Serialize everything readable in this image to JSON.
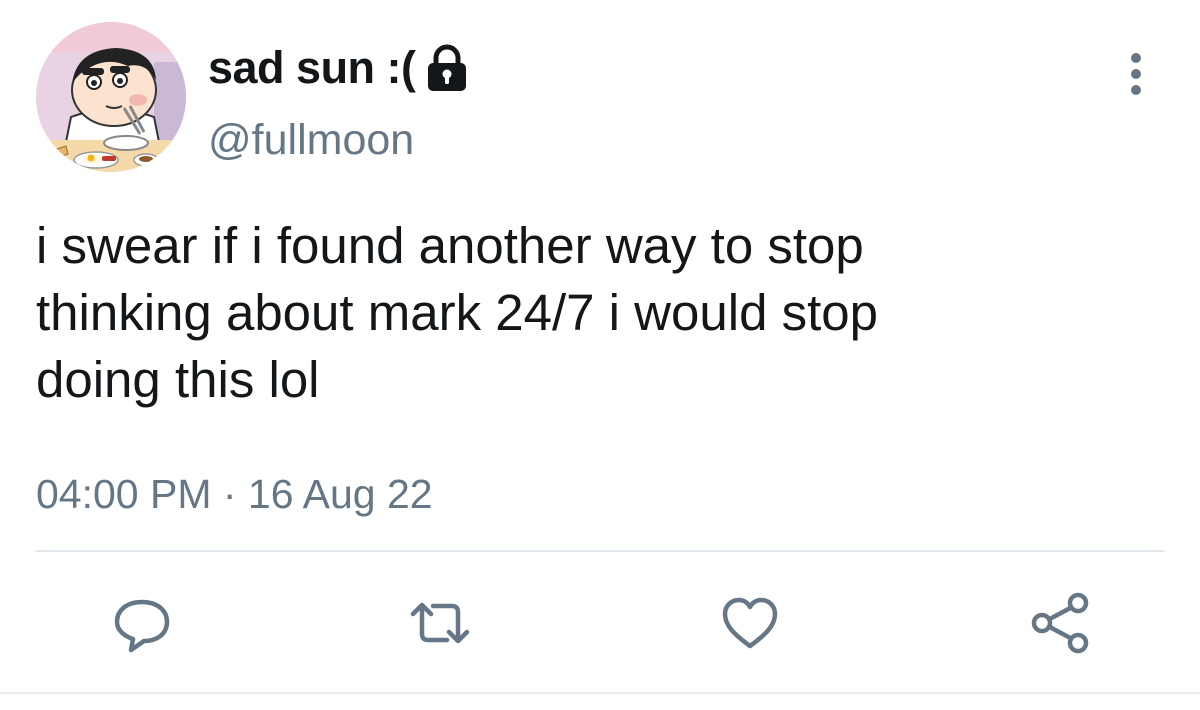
{
  "tweet": {
    "display_name": "sad sun :(",
    "handle": "@fullmoon",
    "protected": true,
    "text": "i swear if i found another way to stop\nthinking about mark 24/7 i would stop\ndoing this lol",
    "timestamp": "04:00 PM · 16 Aug 22"
  },
  "icons": {
    "lock": "lock-icon",
    "more": "more-vertical-icon",
    "reply": "reply-icon",
    "retweet": "retweet-icon",
    "like": "heart-icon",
    "share": "share-icon"
  },
  "colors": {
    "text_primary": "#14171a",
    "text_secondary": "#657786",
    "icon": "#657786",
    "divider": "#e1e8ed",
    "background": "#ffffff"
  }
}
